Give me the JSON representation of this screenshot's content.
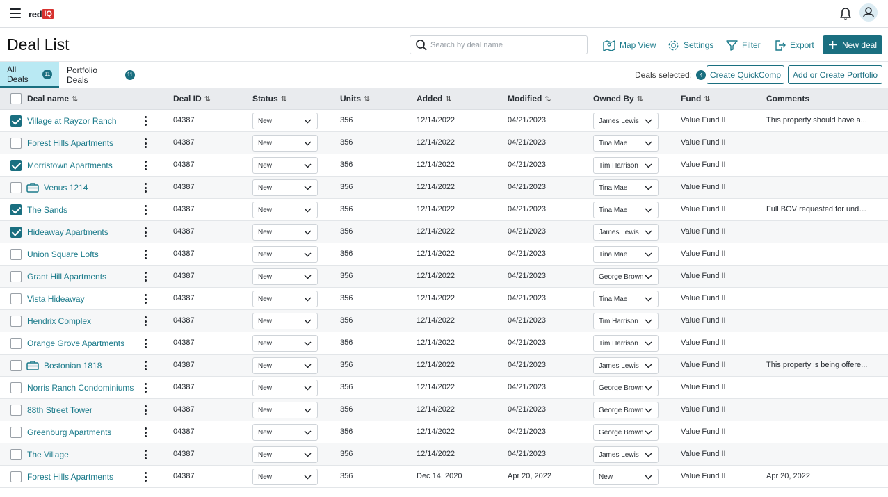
{
  "app": {
    "logo_red": "red",
    "logo_iq": "IQ"
  },
  "header": {
    "title": "Deal List",
    "search_placeholder": "Search by deal name",
    "map_view": "Map View",
    "settings": "Settings",
    "filter": "Filter",
    "export": "Export",
    "new_deal": "New deal"
  },
  "tabs": {
    "all_deals": {
      "label": "All Deals",
      "count": "11"
    },
    "portfolio_deals": {
      "label": "Portfolio Deals",
      "count": "11"
    },
    "deals_selected_label": "Deals selected:",
    "deals_selected_count": "4",
    "create_quickcomp": "Create QuickComp",
    "add_portfolio": "Add or Create Portfolio"
  },
  "columns": {
    "deal_name": "Deal name",
    "deal_id": "Deal ID",
    "status": "Status",
    "units": "Units",
    "added": "Added",
    "modified": "Modified",
    "owned_by": "Owned By",
    "fund": "Fund",
    "comments": "Comments"
  },
  "colors": {
    "accent": "#1a6f80",
    "link": "#1a7a8a",
    "tab_active": "#b9e9f3",
    "logo_red": "#d7322f"
  },
  "rows": [
    {
      "name": "Village at Rayzor Ranch",
      "checked": true,
      "portfolio": false,
      "id": "04387",
      "status": "New",
      "units": "356",
      "added": "12/14/2022",
      "modified": "04/21/2023",
      "owner": "James Lewis",
      "fund": "Value Fund II",
      "comment": "This property should have a..."
    },
    {
      "name": "Forest Hills Apartments",
      "checked": false,
      "portfolio": false,
      "id": "04387",
      "status": "New",
      "units": "356",
      "added": "12/14/2022",
      "modified": "04/21/2023",
      "owner": "Tina Mae",
      "fund": "Value Fund II",
      "comment": ""
    },
    {
      "name": "Morristown Apartments",
      "checked": true,
      "portfolio": false,
      "id": "04387",
      "status": "New",
      "units": "356",
      "added": "12/14/2022",
      "modified": "04/21/2023",
      "owner": "Tim Harrison",
      "fund": "Value Fund II",
      "comment": ""
    },
    {
      "name": "Venus 1214",
      "checked": false,
      "portfolio": true,
      "id": "04387",
      "status": "New",
      "units": "356",
      "added": "12/14/2022",
      "modified": "04/21/2023",
      "owner": "Tina Mae",
      "fund": "Value Fund II",
      "comment": ""
    },
    {
      "name": "The Sands",
      "checked": true,
      "portfolio": false,
      "id": "04387",
      "status": "New",
      "units": "356",
      "added": "12/14/2022",
      "modified": "04/21/2023",
      "owner": "Tina Mae",
      "fund": "Value Fund II",
      "comment": "Full BOV requested for unde..."
    },
    {
      "name": "Hideaway Apartments",
      "checked": true,
      "portfolio": false,
      "id": "04387",
      "status": "New",
      "units": "356",
      "added": "12/14/2022",
      "modified": "04/21/2023",
      "owner": "James Lewis",
      "fund": "Value Fund II",
      "comment": ""
    },
    {
      "name": "Union Square Lofts",
      "checked": false,
      "portfolio": false,
      "id": "04387",
      "status": "New",
      "units": "356",
      "added": "12/14/2022",
      "modified": "04/21/2023",
      "owner": "Tina Mae",
      "fund": "Value Fund II",
      "comment": ""
    },
    {
      "name": "Grant Hill Apartments",
      "checked": false,
      "portfolio": false,
      "id": "04387",
      "status": "New",
      "units": "356",
      "added": "12/14/2022",
      "modified": "04/21/2023",
      "owner": "George Brown",
      "fund": "Value Fund II",
      "comment": ""
    },
    {
      "name": "Vista Hideaway",
      "checked": false,
      "portfolio": false,
      "id": "04387",
      "status": "New",
      "units": "356",
      "added": "12/14/2022",
      "modified": "04/21/2023",
      "owner": "Tina Mae",
      "fund": "Value Fund II",
      "comment": ""
    },
    {
      "name": "Hendrix Complex",
      "checked": false,
      "portfolio": false,
      "id": "04387",
      "status": "New",
      "units": "356",
      "added": "12/14/2022",
      "modified": "04/21/2023",
      "owner": "Tim Harrison",
      "fund": "Value Fund II",
      "comment": ""
    },
    {
      "name": "Orange Grove Apartments",
      "checked": false,
      "portfolio": false,
      "id": "04387",
      "status": "New",
      "units": "356",
      "added": "12/14/2022",
      "modified": "04/21/2023",
      "owner": "Tim Harrison",
      "fund": "Value Fund II",
      "comment": ""
    },
    {
      "name": "Bostonian 1818",
      "checked": false,
      "portfolio": true,
      "id": "04387",
      "status": "New",
      "units": "356",
      "added": "12/14/2022",
      "modified": "04/21/2023",
      "owner": "James Lewis",
      "fund": "Value Fund II",
      "comment": "This property is being offere..."
    },
    {
      "name": "Norris Ranch Condominiums",
      "checked": false,
      "portfolio": false,
      "id": "04387",
      "status": "New",
      "units": "356",
      "added": "12/14/2022",
      "modified": "04/21/2023",
      "owner": "George Brown",
      "fund": "Value Fund II",
      "comment": ""
    },
    {
      "name": "88th Street Tower",
      "checked": false,
      "portfolio": false,
      "id": "04387",
      "status": "New",
      "units": "356",
      "added": "12/14/2022",
      "modified": "04/21/2023",
      "owner": "George Brown",
      "fund": "Value Fund II",
      "comment": ""
    },
    {
      "name": "Greenburg Apartments",
      "checked": false,
      "portfolio": false,
      "id": "04387",
      "status": "New",
      "units": "356",
      "added": "12/14/2022",
      "modified": "04/21/2023",
      "owner": "George Brown",
      "fund": "Value Fund II",
      "comment": ""
    },
    {
      "name": "The Village",
      "checked": false,
      "portfolio": false,
      "id": "04387",
      "status": "New",
      "units": "356",
      "added": "12/14/2022",
      "modified": "04/21/2023",
      "owner": "James Lewis",
      "fund": "Value Fund II",
      "comment": ""
    },
    {
      "name": "Forest Hills Apartments",
      "checked": false,
      "portfolio": false,
      "id": "04387",
      "status": "New",
      "units": "356",
      "added": "Dec 14, 2020",
      "modified": "Apr 20, 2022",
      "owner": "New",
      "fund": "Value Fund II",
      "comment": "Apr 20, 2022"
    }
  ]
}
